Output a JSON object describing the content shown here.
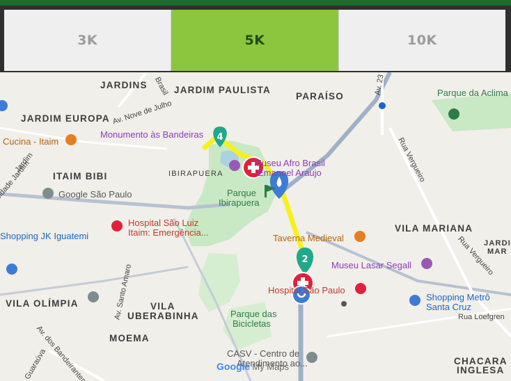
{
  "tabs": [
    {
      "label": "3K",
      "active": false
    },
    {
      "label": "5K",
      "active": true
    },
    {
      "label": "10K",
      "active": false
    }
  ],
  "map": {
    "districts": {
      "jardins": "JARDINS",
      "jardim_paulista": "JARDIM PAULISTA",
      "paraiso": "PARAÍSO",
      "jardim_europa": "JARDIM EUROPA",
      "itaim_bibi": "ITAIM BIBI",
      "ibirapuera": "IBIRAPUERA",
      "vila_mariana": "VILA MARIANA",
      "vila_olimpia": "VILA OLÍMPIA",
      "vila_uberabinha_1": "VILA",
      "vila_uberabinha_2": "UBERABINHA",
      "moema": "MOEMA",
      "chacara_1": "CHACARA",
      "chacara_2": "INGLESA",
      "jardim_right": "JARDIM",
      "mar_right": "MAR"
    },
    "pois": {
      "monumento": "Monumento às Bandeiras",
      "museu_afro_1": "Museu Afro Brasil",
      "museu_afro_2": "Emanoel Araujo",
      "parque_ibira_1": "Parque",
      "parque_ibira_2": "Ibirapuera",
      "cucina": "Cucina - Itaim",
      "google_sp": "Google São Paulo",
      "hospital_luiz_1": "Hospital São Luiz",
      "hospital_luiz_2": "Itaim: Emergência...",
      "shopping_jk": "Shopping JK Iguatemi",
      "taverna": "Taverna Medieval",
      "museu_lasar": "Museu Lasar Segall",
      "hospital_sp": "Hospital São Paulo",
      "shopping_metro_1": "Shopping Metrô",
      "shopping_metro_2": "Santa Cruz",
      "parque_bic_1": "Parque das",
      "parque_bic_2": "Bicicletas",
      "casv_1": "CASV - Centro de",
      "casv_2": "Atendimento ao...",
      "parque_aclima": "Parque da Aclima"
    },
    "streets": {
      "nove_julho": "Av. Nove de Julho",
      "brasil": "Brasil",
      "jardim": "Jardim",
      "cidade_jardim": "Cidade Jardim",
      "vergueiro": "Rua Vergueiro",
      "vergueiro2": "Rua Vergueiro",
      "santo_amaro": "Av. Santo Amaro",
      "bandeirantes": "Av. dos Bandeirantes",
      "guarauva": "R. Guaraúva",
      "loefgren": "Rua Loefgren",
      "av23": "Av. 23"
    },
    "markers": {
      "marker_4": "4",
      "marker_2": "2"
    },
    "logo": {
      "google": "Google",
      "mymaps": "My Maps"
    },
    "colors": {
      "route": "#f7f021",
      "park": "#c9e8c4",
      "marker_teal": "#1fa98a",
      "hospital_red": "#e0213c",
      "water_blue": "#3d7bd6",
      "tab_active": "#8cc63f"
    }
  }
}
